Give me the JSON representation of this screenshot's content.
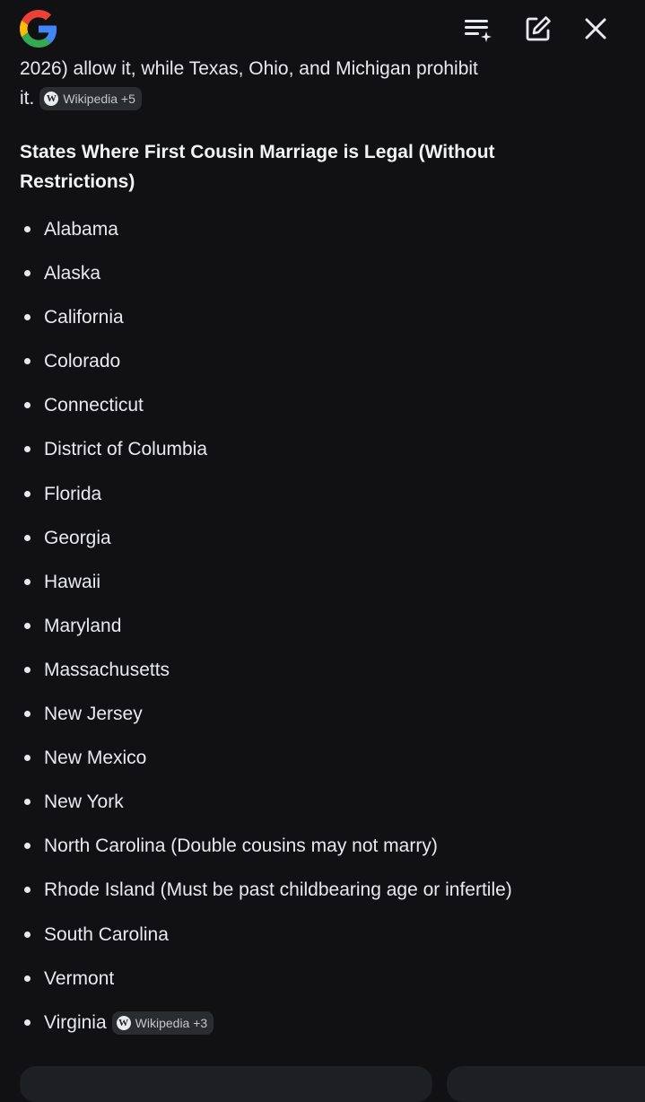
{
  "header": {
    "logo": "google-g-logo",
    "icons": [
      "list-sparkle-icon",
      "edit-icon",
      "close-icon"
    ]
  },
  "intro": {
    "line1": "2026) allow it, while Texas, Ohio, and Michigan prohibit",
    "line2": "it.",
    "chip": {
      "label": "Wikipedia +5",
      "icon": "wikipedia-icon"
    }
  },
  "section": {
    "heading": "States Where First Cousin Marriage is Legal (Without Restrictions)"
  },
  "states": [
    "Alabama",
    "Alaska",
    "California",
    "Colorado",
    "Connecticut",
    "District of Columbia",
    "Florida",
    "Georgia",
    "Hawaii",
    "Maryland",
    "Massachusetts",
    "New Jersey",
    "New Mexico",
    "New York",
    "North Carolina (Double cousins may not marry)",
    "Rhode Island (Must be past childbearing age or infertile)",
    "South Carolina",
    "Vermont",
    "Virginia"
  ],
  "last_chip": {
    "label": "Wikipedia +3",
    "icon": "wikipedia-icon"
  },
  "colors": {
    "background": "#111114",
    "text": "#e8eaed",
    "chip": "#2b2c30"
  }
}
